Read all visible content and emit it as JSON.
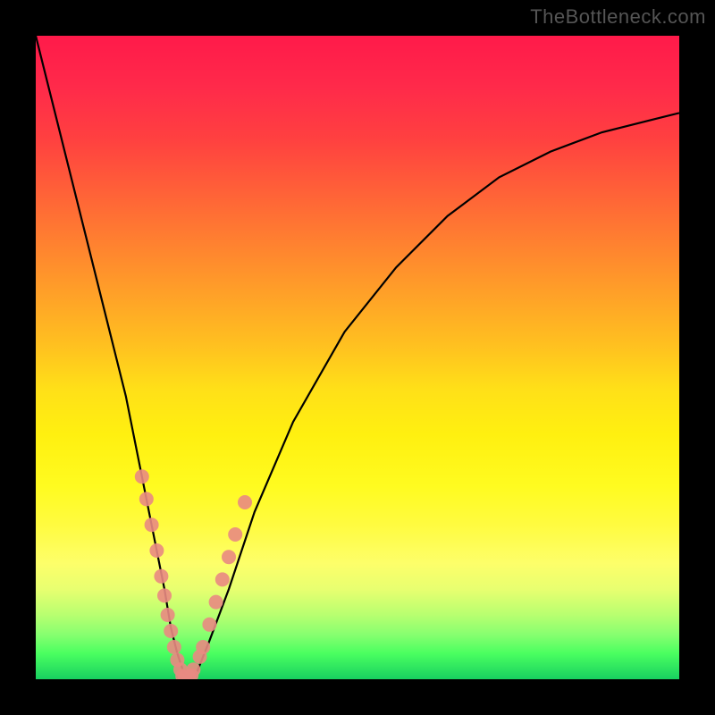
{
  "watermark": "TheBottleneck.com",
  "chart_data": {
    "type": "line",
    "title": "",
    "xlabel": "",
    "ylabel": "",
    "xlim": [
      0,
      100
    ],
    "ylim": [
      0,
      100
    ],
    "grid": false,
    "legend": false,
    "background_gradient": {
      "direction": "vertical",
      "stops": [
        {
          "pos": 0,
          "color": "#ff1a4a"
        },
        {
          "pos": 50,
          "color": "#ffd018"
        },
        {
          "pos": 85,
          "color": "#fdff6a"
        },
        {
          "pos": 100,
          "color": "#18d060"
        }
      ],
      "meaning": "red (top) = high bottleneck %, green (bottom) = low bottleneck %"
    },
    "series": [
      {
        "name": "bottleneck-curve",
        "type": "line",
        "color": "#000000",
        "x": [
          0,
          2,
          5,
          8,
          11,
          14,
          16,
          18,
          20,
          21,
          22,
          23,
          24,
          25,
          27,
          30,
          34,
          40,
          48,
          56,
          64,
          72,
          80,
          88,
          96,
          100
        ],
        "values": [
          100,
          92,
          80,
          68,
          56,
          44,
          34,
          24,
          14,
          8,
          4,
          1,
          0,
          1,
          6,
          14,
          26,
          40,
          54,
          64,
          72,
          78,
          82,
          85,
          87,
          88
        ]
      },
      {
        "name": "left-branch-markers",
        "type": "scatter",
        "color": "#e98a82",
        "marker": "circle",
        "x": [
          16.5,
          17.2,
          18.0,
          18.8,
          19.5,
          20.0,
          20.5,
          21.0,
          21.5,
          22.0,
          22.5
        ],
        "values": [
          31.5,
          28.0,
          24.0,
          20.0,
          16.0,
          13.0,
          10.0,
          7.5,
          5.0,
          3.0,
          1.5
        ]
      },
      {
        "name": "right-branch-markers",
        "type": "scatter",
        "color": "#e98a82",
        "marker": "circle",
        "x": [
          24.5,
          25.5,
          26.0,
          27.0,
          28.0,
          29.0,
          30.0,
          31.0,
          32.5
        ],
        "values": [
          1.5,
          3.5,
          5.0,
          8.5,
          12.0,
          15.5,
          19.0,
          22.5,
          27.5
        ]
      },
      {
        "name": "trough-markers",
        "type": "scatter",
        "color": "#e98a82",
        "marker": "circle",
        "x": [
          22.8,
          23.2,
          23.8,
          24.2
        ],
        "values": [
          0.5,
          0.3,
          0.3,
          0.6
        ]
      }
    ],
    "minimum_point": {
      "x": 23,
      "value": 0
    }
  }
}
